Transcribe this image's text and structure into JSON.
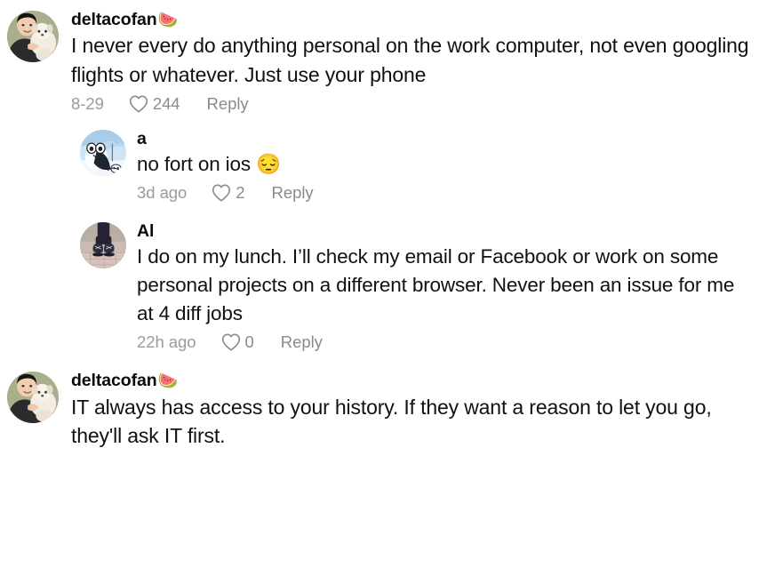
{
  "app": {
    "view": "comment-thread"
  },
  "comments": [
    {
      "username": "deltacofan",
      "badge_emoji": "🍉",
      "text": "I never every do anything personal on the work computer, not even googling flights or whatever. Just use your phone",
      "time": "8-29",
      "likes": "244",
      "reply_label": "Reply",
      "is_reply": false,
      "avatar": "person-holding-white-dog"
    },
    {
      "username": "a",
      "badge_emoji": "",
      "text": "no fort on ios 😔",
      "time": "3d ago",
      "likes": "2",
      "reply_label": "Reply",
      "is_reply": true,
      "avatar": "cartoon-penguin-with-umbrella"
    },
    {
      "username": "Al",
      "badge_emoji": "",
      "text": "I do on my lunch. I’ll check my email or Facebook or work on some personal projects on a different browser. Never been an issue for me at 4 diff jobs",
      "time": "22h ago",
      "likes": "0",
      "reply_label": "Reply",
      "is_reply": true,
      "avatar": "boots-on-pavement"
    },
    {
      "username": "deltacofan",
      "badge_emoji": "🍉",
      "text": "IT always has access to your history. If they want a reason to let you go, they'll ask IT first.",
      "time": "",
      "likes": "",
      "reply_label": "",
      "is_reply": false,
      "avatar": "person-holding-white-dog"
    }
  ],
  "icons": {
    "like": "heart-icon"
  },
  "colors": {
    "text": "#111111",
    "username": "#0b0b0b",
    "meta": "#8c8c8c",
    "background": "#ffffff"
  }
}
